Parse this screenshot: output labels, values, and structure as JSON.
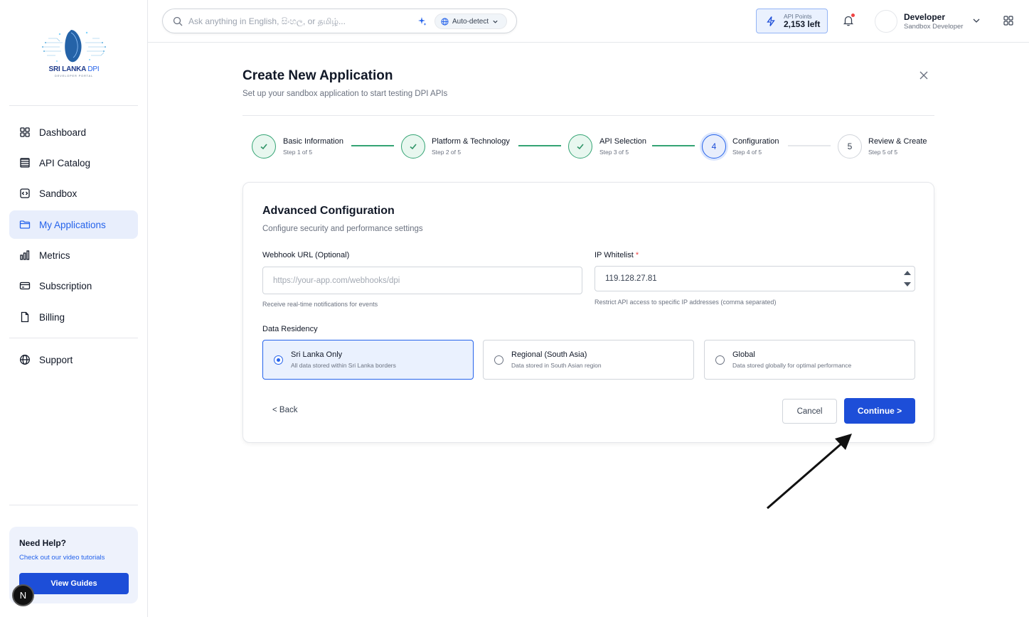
{
  "brand": {
    "name": "SRI LANKA",
    "name_accent": "DPI",
    "subtitle": "DEVELOPER PORTAL"
  },
  "sidebar": {
    "items": [
      {
        "label": "Dashboard",
        "icon": "grid-icon",
        "active": false
      },
      {
        "label": "API Catalog",
        "icon": "layers-icon",
        "active": false
      },
      {
        "label": "Sandbox",
        "icon": "code-box-icon",
        "active": false
      },
      {
        "label": "My Applications",
        "icon": "folder-icon",
        "active": true
      },
      {
        "label": "Metrics",
        "icon": "bar-chart-icon",
        "active": false
      },
      {
        "label": "Subscription",
        "icon": "credit-card-icon",
        "active": false
      },
      {
        "label": "Billing",
        "icon": "file-icon",
        "active": false
      },
      {
        "label": "Support",
        "icon": "globe-icon",
        "active": false
      }
    ],
    "help": {
      "title": "Need Help?",
      "subtitle": "Check out our video tutorials",
      "button": "View Guides"
    },
    "badge": "N"
  },
  "header": {
    "search_placeholder": "Ask anything in English, සිංහල, or தமிழ்...",
    "language": "Auto-detect",
    "points_label": "API Points",
    "points_value": "2,153 left",
    "user_name": "Developer",
    "user_role": "Sandbox Developer"
  },
  "page": {
    "title": "Create New Application",
    "subtitle": "Set up your sandbox application to start testing DPI APIs"
  },
  "steps": [
    {
      "title": "Basic Information",
      "sub": "Step 1 of 5",
      "status": "done",
      "number": "1"
    },
    {
      "title": "Platform & Technology",
      "sub": "Step 2 of 5",
      "status": "done",
      "number": "2"
    },
    {
      "title": "API Selection",
      "sub": "Step 3 of 5",
      "status": "done",
      "number": "3"
    },
    {
      "title": "Configuration",
      "sub": "Step 4 of 5",
      "status": "current",
      "number": "4"
    },
    {
      "title": "Review & Create",
      "sub": "Step 5 of 5",
      "status": "todo",
      "number": "5"
    }
  ],
  "form": {
    "title": "Advanced Configuration",
    "subtitle": "Configure security and performance settings",
    "webhook": {
      "label": "Webhook URL (Optional)",
      "placeholder": "https://your-app.com/webhooks/dpi",
      "value": "",
      "help": "Receive real-time notifications for events"
    },
    "ip": {
      "label": "IP Whitelist",
      "required_mark": "*",
      "value": "119.128.27.81",
      "help": "Restrict API access to specific IP addresses (comma separated)"
    },
    "residency": {
      "label": "Data Residency",
      "options": [
        {
          "title": "Sri Lanka Only",
          "sub": "All data stored within Sri Lanka borders",
          "selected": true
        },
        {
          "title": "Regional (South Asia)",
          "sub": "Data stored in South Asian region",
          "selected": false
        },
        {
          "title": "Global",
          "sub": "Data stored globally for optimal performance",
          "selected": false
        }
      ]
    },
    "back": "< Back",
    "cancel": "Cancel",
    "continue": "Continue >"
  },
  "colors": {
    "accent": "#1d4ed8",
    "success": "#34a474",
    "active_bg": "#e8eefc"
  }
}
